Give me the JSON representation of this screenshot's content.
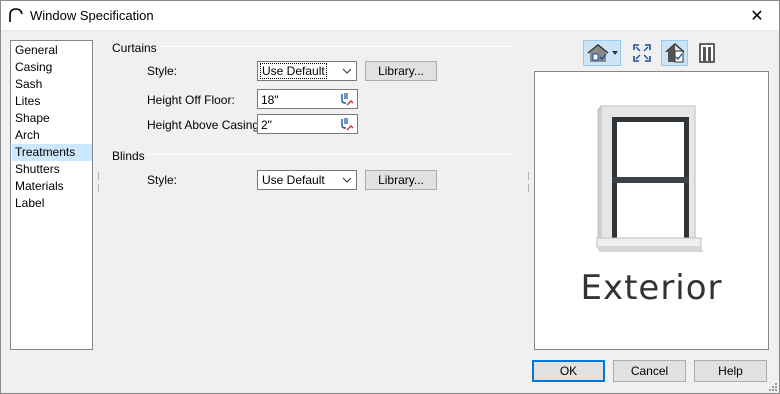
{
  "window": {
    "title": "Window Specification",
    "close_glyph": "✕"
  },
  "sidebar": {
    "selected": "Treatments",
    "items": [
      "General",
      "Casing",
      "Sash",
      "Lites",
      "Shape",
      "Arch",
      "Treatments",
      "Shutters",
      "Materials",
      "Label"
    ]
  },
  "curtains": {
    "title": "Curtains",
    "style_label": "Style:",
    "style_value": "Use Default",
    "library_label": "Library...",
    "height_off_floor_label": "Height Off Floor:",
    "height_off_floor_value": "18\"",
    "height_above_casing_label": "Height Above Casing:",
    "height_above_casing_value": "2\""
  },
  "blinds": {
    "title": "Blinds",
    "style_label": "Style:",
    "style_value": "Use Default",
    "library_label": "Library..."
  },
  "preview": {
    "label": "Exterior",
    "toolbar_icons": [
      "house-view-dropdown-icon",
      "fit-to-view-icon",
      "exterior-view-toggle-icon",
      "interior-view-icon"
    ]
  },
  "footer": {
    "ok_label": "OK",
    "cancel_label": "Cancel",
    "help_label": "Help"
  },
  "colors": {
    "selection": "#cce8ff",
    "accent": "#0078d7",
    "toolbar_active": "#cce4f7"
  }
}
